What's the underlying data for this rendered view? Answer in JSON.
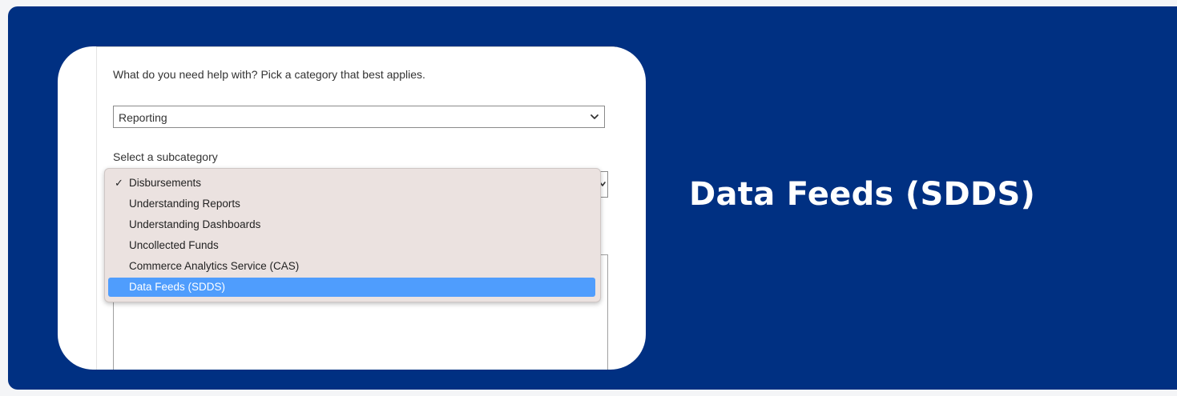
{
  "form": {
    "question": "What do you need help with? Pick a category that best applies.",
    "category_value": "Reporting",
    "subcategory_label": "Select a subcategory"
  },
  "dropdown": {
    "items": [
      {
        "label": "Disbursements",
        "checked": true
      },
      {
        "label": "Understanding Reports"
      },
      {
        "label": "Understanding Dashboards"
      },
      {
        "label": "Uncollected Funds"
      },
      {
        "label": "Commerce Analytics Service (CAS)"
      },
      {
        "label": "Data Feeds (SDDS)",
        "highlighted": true
      }
    ],
    "check_glyph": "✓"
  },
  "headline": "Data Feeds (SDDS)",
  "colors": {
    "banner": "#003082",
    "highlight": "#4f9dfd",
    "dropdown_bg": "#ebe2e0"
  }
}
